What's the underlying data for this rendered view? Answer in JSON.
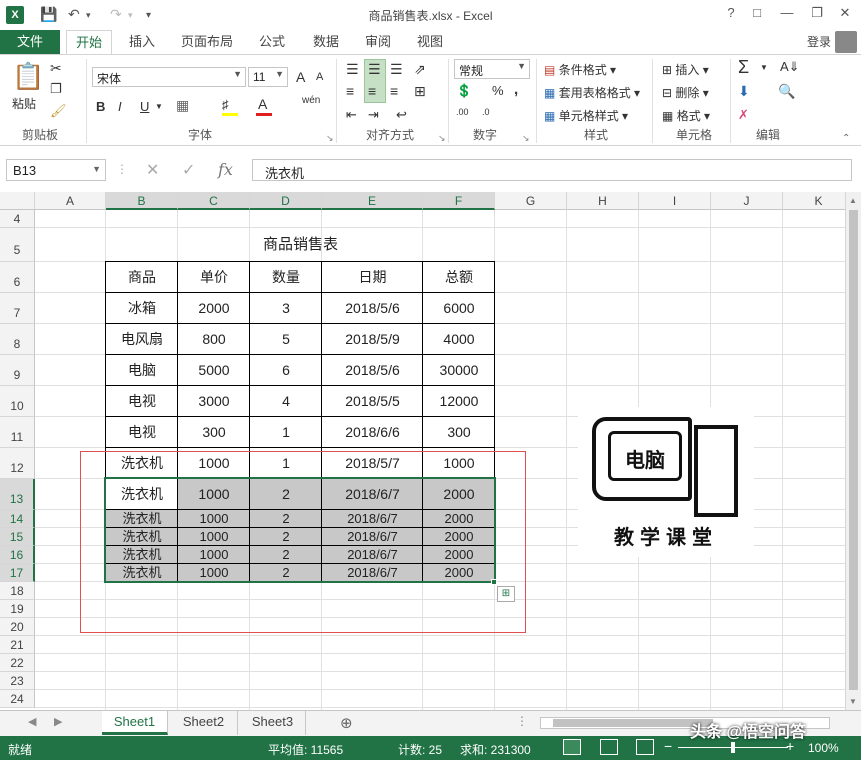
{
  "window": {
    "title": "商品销售表.xlsx - Excel",
    "app_icon": "X",
    "buttons": [
      "?",
      "□",
      "—",
      "❐",
      "✕"
    ]
  },
  "ribbon_tabs": [
    "文件",
    "开始",
    "插入",
    "页面布局",
    "公式",
    "数据",
    "审阅",
    "视图"
  ],
  "active_tab": "开始",
  "login": "登录",
  "ribbon": {
    "clipboard": {
      "paste": "粘贴",
      "label": "剪贴板"
    },
    "font": {
      "name": "宋体",
      "size": "11",
      "label": "字体",
      "bold": "B",
      "italic": "I",
      "underline": "U",
      "phonetic": "wén",
      "grow": "A",
      "shrink": "A"
    },
    "alignment": {
      "label": "对齐方式"
    },
    "number": {
      "format": "常规",
      "label": "数字",
      "percent": "%",
      "comma": ",",
      "dec_inc": ".00",
      "dec_dec": ".0"
    },
    "styles": {
      "conditional": "条件格式",
      "as_table": "套用表格格式",
      "cell_styles": "单元格样式",
      "label": "样式"
    },
    "cells": {
      "insert": "插入",
      "delete": "删除",
      "format": "格式",
      "label": "单元格"
    },
    "editing": {
      "label": "编辑"
    }
  },
  "formula_bar": {
    "name_box": "B13",
    "formula": "洗衣机"
  },
  "columns": [
    "A",
    "B",
    "C",
    "D",
    "E",
    "F",
    "G",
    "H",
    "I",
    "J",
    "K"
  ],
  "rows": [
    "4",
    "5",
    "6",
    "7",
    "8",
    "9",
    "10",
    "11",
    "12",
    "13",
    "14",
    "15",
    "16",
    "17",
    "18",
    "19",
    "20",
    "21",
    "22",
    "23",
    "24"
  ],
  "table": {
    "title": "商品销售表",
    "headers": [
      "商品",
      "单价",
      "数量",
      "日期",
      "总额"
    ],
    "rows": [
      [
        "冰箱",
        "2000",
        "3",
        "2018/5/6",
        "6000"
      ],
      [
        "电风扇",
        "800",
        "5",
        "2018/5/9",
        "4000"
      ],
      [
        "电脑",
        "5000",
        "6",
        "2018/5/6",
        "30000"
      ],
      [
        "电视",
        "3000",
        "4",
        "2018/5/5",
        "12000"
      ],
      [
        "电视",
        "300",
        "1",
        "2018/6/6",
        "300"
      ],
      [
        "洗衣机",
        "1000",
        "1",
        "2018/5/7",
        "1000"
      ],
      [
        "洗衣机",
        "1000",
        "2",
        "2018/6/7",
        "2000"
      ],
      [
        "洗衣机",
        "1000",
        "2",
        "2018/6/7",
        "2000"
      ],
      [
        "洗衣机",
        "1000",
        "2",
        "2018/6/7",
        "2000"
      ],
      [
        "洗衣机",
        "1000",
        "2",
        "2018/6/7",
        "2000"
      ],
      [
        "洗衣机",
        "1000",
        "2",
        "2018/6/7",
        "2000"
      ]
    ]
  },
  "watermark": {
    "screen_text": "电脑",
    "brand": "教学课堂"
  },
  "sheets": [
    "Sheet1",
    "Sheet2",
    "Sheet3"
  ],
  "active_sheet": "Sheet1",
  "add_sheet": "⊕",
  "status": {
    "ready": "就绪",
    "average": "平均值: 11565",
    "count": "计数: 25",
    "sum": "求和: 231300",
    "zoom": "100%",
    "overlay": "头条 @悟空问答"
  },
  "colors": {
    "accent": "#217346",
    "selection_fill": "#c8c8c8",
    "annotation": "#e05050"
  }
}
